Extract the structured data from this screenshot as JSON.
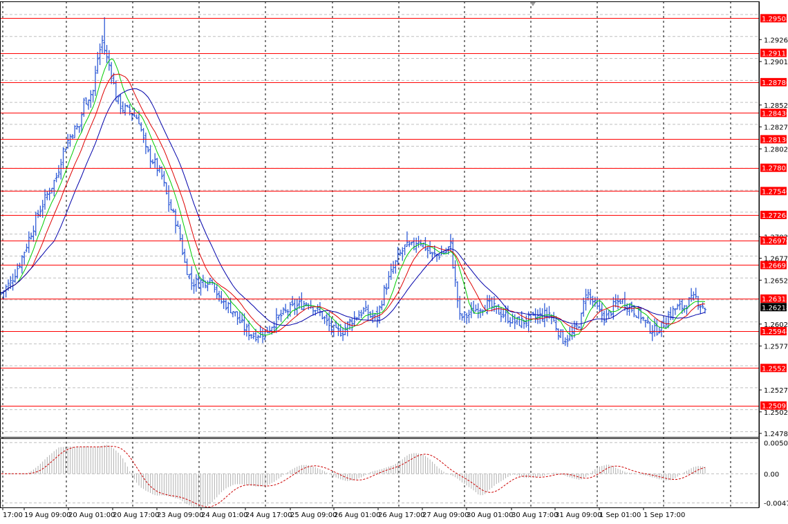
{
  "colors": {
    "background": "#ffffff",
    "frame": "#000000",
    "grid": "#bfbfbf",
    "vgrid": "#000000",
    "candle": "#2f5bd6",
    "level": "#ff0000",
    "level_label_bg": "#ff0000",
    "level_label_text": "#ffffff",
    "current_label_bg": "#000000",
    "current_label_text": "#ffffff",
    "ma_fast": "#00cc00",
    "ma_mid": "#dd0000",
    "ma_slow": "#0000aa",
    "osc_hist": "#b0b0b0",
    "osc_signal": "#cc0000",
    "axis_text": "#000000"
  },
  "chart_data": {
    "type": "candlestick",
    "price_axis": {
      "ticks": [
        "1.29265",
        "1.29015",
        "1.28520",
        "1.28270",
        "1.28020",
        "1.27020",
        "1.26775",
        "1.26525",
        "1.26025",
        "1.25775",
        "1.25275",
        "1.25025",
        "1.24780"
      ],
      "tick_values": [
        1.29265,
        1.29015,
        1.2852,
        1.2827,
        1.2802,
        1.2702,
        1.26775,
        1.26525,
        1.26025,
        1.25775,
        1.25275,
        1.25025,
        1.2478
      ],
      "ylim": [
        1.2474,
        1.297
      ]
    },
    "levels": [
      {
        "label": "1.29508",
        "value": 1.29508
      },
      {
        "label": "1.29113",
        "value": 1.29113
      },
      {
        "label": "1.28780",
        "value": 1.2878
      },
      {
        "label": "1.28430",
        "value": 1.2843
      },
      {
        "label": "1.28130",
        "value": 1.2813
      },
      {
        "label": "1.27805",
        "value": 1.27805
      },
      {
        "label": "1.27540",
        "value": 1.2754
      },
      {
        "label": "1.27268",
        "value": 1.27268
      },
      {
        "label": "1.26976",
        "value": 1.26976
      },
      {
        "label": "1.26697",
        "value": 1.26697
      },
      {
        "label": "1.26315",
        "value": 1.26315
      },
      {
        "label": "1.25944",
        "value": 1.25944
      },
      {
        "label": "1.25525",
        "value": 1.25525
      },
      {
        "label": "1.25097",
        "value": 1.25097
      }
    ],
    "current_price": {
      "label": "1.26218",
      "value": 1.26218
    },
    "time_labels": [
      "17:00",
      "19 Aug 09:00",
      "20 Aug 01:00",
      "20 Aug 17:00",
      "23 Aug 09:00",
      "24 Aug 01:00",
      "24 Aug 17:00",
      "25 Aug 09:00",
      "26 Aug 01:00",
      "26 Aug 17:00",
      "27 Aug 09:00",
      "30 Aug 01:00",
      "30 Aug 17:00",
      "31 Aug 09:00",
      "1 Sep 01:00",
      "1 Sep 17:00"
    ],
    "anchors": [
      [
        0,
        1.2638
      ],
      [
        4,
        1.265
      ],
      [
        8,
        1.2672
      ],
      [
        12,
        1.27
      ],
      [
        16,
        1.2728
      ],
      [
        20,
        1.275
      ],
      [
        24,
        1.277
      ],
      [
        27,
        1.28
      ],
      [
        31,
        1.2822
      ],
      [
        34,
        1.2828
      ],
      [
        36,
        1.2855
      ],
      [
        40,
        1.2868
      ],
      [
        42,
        1.2905
      ],
      [
        44,
        1.2925
      ],
      [
        46,
        1.2905
      ],
      [
        48,
        1.289
      ],
      [
        50,
        1.286
      ],
      [
        53,
        1.2848
      ],
      [
        56,
        1.2845
      ],
      [
        60,
        1.2835
      ],
      [
        63,
        1.28
      ],
      [
        67,
        1.2785
      ],
      [
        70,
        1.277
      ],
      [
        73,
        1.274
      ],
      [
        76,
        1.272
      ],
      [
        78,
        1.27
      ],
      [
        80,
        1.2672
      ],
      [
        83,
        1.265
      ],
      [
        86,
        1.265
      ],
      [
        89,
        1.2652
      ],
      [
        92,
        1.2655
      ],
      [
        95,
        1.263
      ],
      [
        98,
        1.2625
      ],
      [
        101,
        1.2618
      ],
      [
        104,
        1.2605
      ],
      [
        107,
        1.2595
      ],
      [
        110,
        1.259
      ],
      [
        113,
        1.2592
      ],
      [
        116,
        1.2595
      ],
      [
        119,
        1.2605
      ],
      [
        122,
        1.2612
      ],
      [
        125,
        1.2618
      ],
      [
        128,
        1.2622
      ],
      [
        131,
        1.2625
      ],
      [
        134,
        1.2628
      ],
      [
        137,
        1.262
      ],
      [
        140,
        1.2612
      ],
      [
        143,
        1.26
      ],
      [
        146,
        1.2593
      ],
      [
        149,
        1.2595
      ],
      [
        152,
        1.2605
      ],
      [
        155,
        1.2612
      ],
      [
        158,
        1.2618
      ],
      [
        161,
        1.2612
      ],
      [
        164,
        1.261
      ],
      [
        167,
        1.264
      ],
      [
        170,
        1.266
      ],
      [
        173,
        1.2678
      ],
      [
        176,
        1.269
      ],
      [
        179,
        1.269
      ],
      [
        182,
        1.27
      ],
      [
        185,
        1.269
      ],
      [
        188,
        1.268
      ],
      [
        191,
        1.2682
      ],
      [
        194,
        1.2685
      ],
      [
        196,
        1.2692
      ],
      [
        198,
        1.265
      ],
      [
        200,
        1.261
      ],
      [
        203,
        1.2612
      ],
      [
        206,
        1.2618
      ],
      [
        209,
        1.2622
      ],
      [
        212,
        1.2625
      ],
      [
        215,
        1.262
      ],
      [
        218,
        1.2615
      ],
      [
        221,
        1.261
      ],
      [
        224,
        1.2605
      ],
      [
        227,
        1.2605
      ],
      [
        230,
        1.2607
      ],
      [
        233,
        1.261
      ],
      [
        236,
        1.2612
      ],
      [
        239,
        1.2615
      ],
      [
        242,
        1.26
      ],
      [
        245,
        1.2585
      ],
      [
        248,
        1.2588
      ],
      [
        251,
        1.2598
      ],
      [
        253,
        1.261
      ],
      [
        255,
        1.264
      ],
      [
        258,
        1.2628
      ],
      [
        261,
        1.2615
      ],
      [
        264,
        1.261
      ],
      [
        267,
        1.2622
      ],
      [
        270,
        1.263
      ],
      [
        273,
        1.2625
      ],
      [
        276,
        1.2618
      ],
      [
        279,
        1.2612
      ],
      [
        282,
        1.26
      ],
      [
        285,
        1.2595
      ],
      [
        288,
        1.26
      ],
      [
        291,
        1.2612
      ],
      [
        294,
        1.262
      ],
      [
        297,
        1.2622
      ],
      [
        300,
        1.2628
      ],
      [
        303,
        1.2632
      ],
      [
        305,
        1.2625
      ],
      [
        307,
        1.2621
      ]
    ],
    "indicators": [
      {
        "type": "moving-average",
        "period": 8,
        "color": "#00cc00"
      },
      {
        "type": "moving-average",
        "period": 14,
        "color": "#dd0000"
      },
      {
        "type": "moving-average",
        "period": 24,
        "color": "#0000aa"
      }
    ],
    "oscillator": {
      "axis_ticks": [
        "0.00509",
        "0.00",
        "-0.00476"
      ],
      "tick_values": [
        0.00509,
        0.0,
        -0.00476
      ],
      "ylim": [
        -0.0055,
        0.0058
      ]
    }
  }
}
